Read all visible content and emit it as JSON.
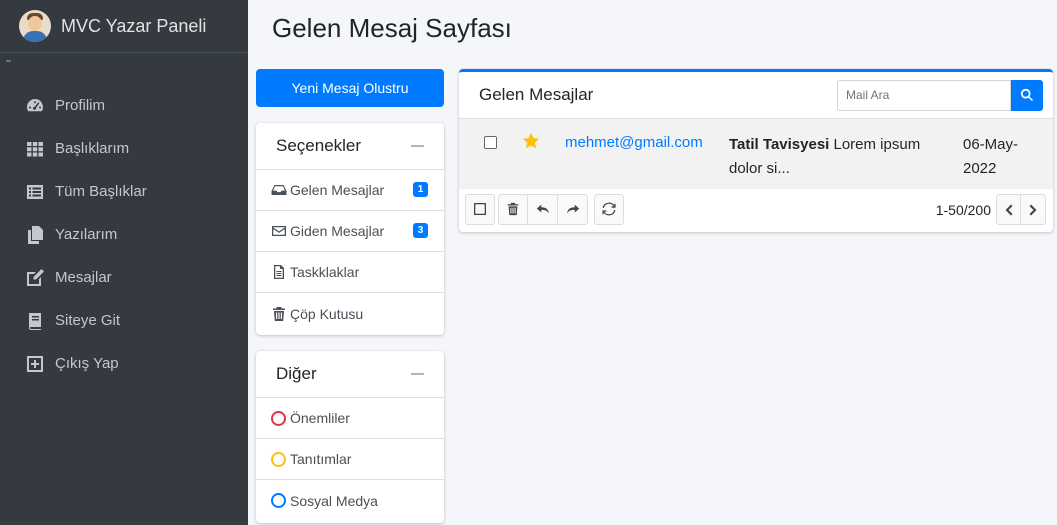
{
  "brand": {
    "title": "MVC Yazar Paneli"
  },
  "sidebar": {
    "items": [
      {
        "label": "Profilim",
        "icon": "tachometer-icon"
      },
      {
        "label": "Başlıklarım",
        "icon": "grid-icon"
      },
      {
        "label": "Tüm Başlıklar",
        "icon": "list-icon"
      },
      {
        "label": "Yazılarım",
        "icon": "copy-icon"
      },
      {
        "label": "Mesajlar",
        "icon": "edit-icon"
      },
      {
        "label": "Siteye Git",
        "icon": "book-icon"
      },
      {
        "label": "Çıkış Yap",
        "icon": "plus-square-icon"
      }
    ]
  },
  "page": {
    "title": "Gelen Mesaj Sayfası"
  },
  "compose": {
    "label": "Yeni Mesaj Olustru"
  },
  "folders": {
    "title": "Seçenekler",
    "items": [
      {
        "label": "Gelen Mesajlar",
        "icon": "inbox-icon",
        "badge": "1"
      },
      {
        "label": "Giden Mesajlar",
        "icon": "envelope-icon",
        "badge": "3"
      },
      {
        "label": "Taskklaklar",
        "icon": "file-icon"
      },
      {
        "label": "Çöp Kutusu",
        "icon": "trash-icon"
      }
    ]
  },
  "labels": {
    "title": "Diğer",
    "items": [
      {
        "label": "Önemliler",
        "color": "#dc3545"
      },
      {
        "label": "Tanıtımlar",
        "color": "#ffc107"
      },
      {
        "label": "Sosyal Medya",
        "color": "#007bff"
      }
    ]
  },
  "inbox": {
    "title": "Gelen Mesajlar",
    "search_placeholder": "Mail Ara",
    "messages": [
      {
        "from": "mehmet@gmail.com",
        "subject": "Tatil Tavisyesi",
        "preview": "Lorem ipsum dolor si...",
        "date": "06-May-2022",
        "starred": true
      }
    ],
    "pager": "1-50/200"
  },
  "colors": {
    "accent": "#007bff",
    "sidebar": "#343a40",
    "star": "#ffc107"
  }
}
